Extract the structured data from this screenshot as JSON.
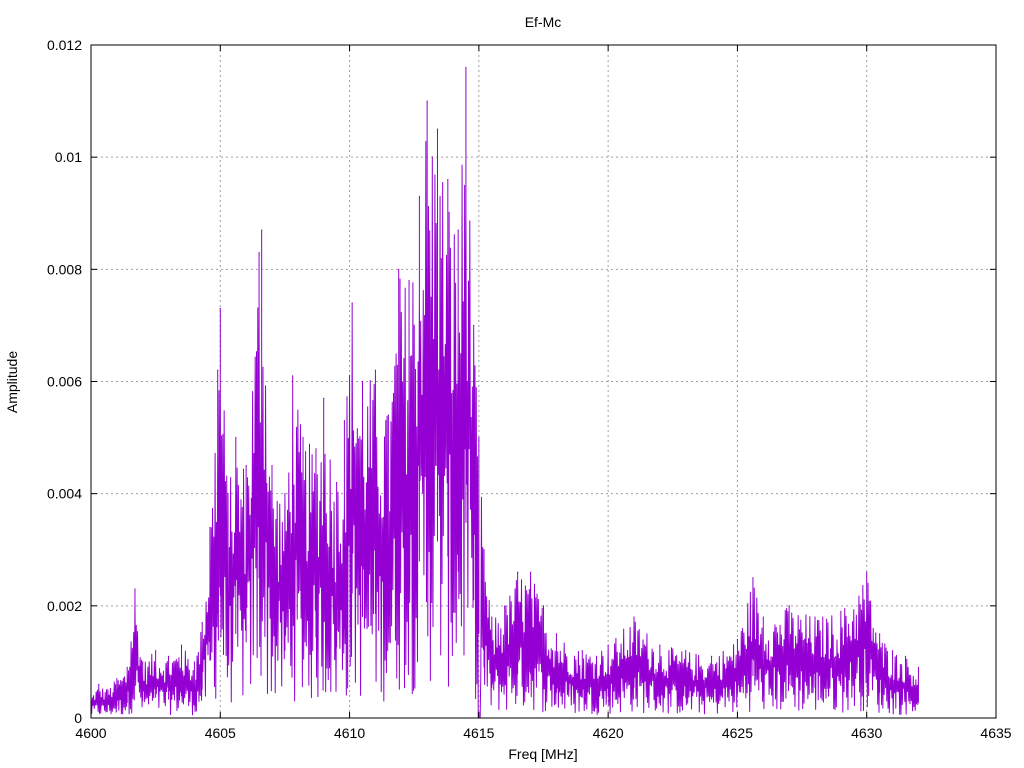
{
  "chart_data": {
    "type": "line",
    "title": "Ef-Mc",
    "xlabel": "Freq [MHz]",
    "ylabel": "Amplitude",
    "xlim": [
      4600,
      4635
    ],
    "ylim": [
      0,
      0.012
    ],
    "xticks": [
      4600,
      4605,
      4610,
      4615,
      4620,
      4625,
      4630,
      4635
    ],
    "yticks": [
      0,
      0.002,
      0.004,
      0.006,
      0.008,
      0.01,
      0.012
    ],
    "xtick_labels": [
      "4600",
      "4605",
      "4610",
      "4615",
      "4620",
      "4625",
      "4630",
      "4635"
    ],
    "ytick_labels": [
      "0",
      "0.002",
      "0.004",
      "0.006",
      "0.008",
      "0.01",
      "0.012"
    ],
    "grid": true,
    "legend": "none",
    "series": [
      {
        "color": "#9400d3",
        "x_range": [
          4600,
          4632
        ],
        "points": [
          [
            4600.0,
            0.0004
          ],
          [
            4600.3,
            0.0006
          ],
          [
            4600.6,
            0.0005
          ],
          [
            4601.0,
            0.0007
          ],
          [
            4601.4,
            0.0009
          ],
          [
            4601.7,
            0.0023
          ],
          [
            4602.0,
            0.001
          ],
          [
            4602.5,
            0.0012
          ],
          [
            4603.0,
            0.0011
          ],
          [
            4603.5,
            0.0013
          ],
          [
            4604.0,
            0.001
          ],
          [
            4604.3,
            0.0017
          ],
          [
            4604.6,
            0.0034
          ],
          [
            4604.9,
            0.0062
          ],
          [
            4605.0,
            0.0073
          ],
          [
            4605.3,
            0.004
          ],
          [
            4605.6,
            0.005
          ],
          [
            4606.0,
            0.0045
          ],
          [
            4606.5,
            0.0083
          ],
          [
            4606.6,
            0.0087
          ],
          [
            4607.0,
            0.0045
          ],
          [
            4607.5,
            0.004
          ],
          [
            4607.8,
            0.0061
          ],
          [
            4608.2,
            0.005
          ],
          [
            4608.7,
            0.0048
          ],
          [
            4609.0,
            0.0057
          ],
          [
            4609.5,
            0.0042
          ],
          [
            4609.8,
            0.0053
          ],
          [
            4610.1,
            0.0074
          ],
          [
            4610.5,
            0.006
          ],
          [
            4611.0,
            0.0062
          ],
          [
            4611.5,
            0.0054
          ],
          [
            4611.9,
            0.008
          ],
          [
            4612.3,
            0.0078
          ],
          [
            4612.7,
            0.0093
          ],
          [
            4613.0,
            0.011
          ],
          [
            4613.4,
            0.0105
          ],
          [
            4613.8,
            0.0096
          ],
          [
            4614.2,
            0.0087
          ],
          [
            4614.5,
            0.0116
          ],
          [
            4614.8,
            0.007
          ],
          [
            4615.0,
            0.005
          ],
          [
            4615.2,
            0.003
          ],
          [
            4615.5,
            0.0018
          ],
          [
            4616.0,
            0.002
          ],
          [
            4616.5,
            0.0026
          ],
          [
            4617.0,
            0.0026
          ],
          [
            4617.5,
            0.002
          ],
          [
            4618.0,
            0.0015
          ],
          [
            4619.0,
            0.0012
          ],
          [
            4620.0,
            0.0013
          ],
          [
            4621.0,
            0.0018
          ],
          [
            4622.0,
            0.0013
          ],
          [
            4623.0,
            0.0012
          ],
          [
            4624.0,
            0.0011
          ],
          [
            4625.0,
            0.0014
          ],
          [
            4625.6,
            0.0025
          ],
          [
            4626.0,
            0.0018
          ],
          [
            4627.0,
            0.002
          ],
          [
            4628.0,
            0.0018
          ],
          [
            4629.0,
            0.0019
          ],
          [
            4630.0,
            0.0026
          ],
          [
            4630.5,
            0.0015
          ],
          [
            4631.0,
            0.0012
          ],
          [
            4631.5,
            0.0011
          ],
          [
            4632.0,
            0.0009
          ]
        ]
      }
    ]
  }
}
